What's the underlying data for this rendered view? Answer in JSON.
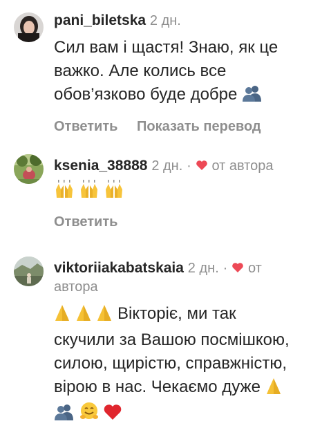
{
  "comments": [
    {
      "username": "pani_biletska",
      "time": "2 дн.",
      "text_lines": [
        "Сил вам і щастя! Знаю, як це",
        "важко. Але колись все",
        "обов’язково буде добре"
      ],
      "trailing_emoji": "hugging-people-icon",
      "actions": {
        "reply": "Ответить",
        "translate": "Показать перевод"
      }
    },
    {
      "username": "ksenia_38888",
      "time": "2 дн.",
      "separator": "·",
      "liked_by_author": "от автора",
      "emoji_row": [
        "raised-hands-icon",
        "raised-hands-icon",
        "raised-hands-icon"
      ],
      "actions": {
        "reply": "Ответить"
      }
    },
    {
      "username": "viktoriiakabatskaia",
      "time": "2 дн.",
      "separator": "·",
      "liked_by_author_line1": "от",
      "liked_by_author_line2": "автора",
      "text_line1": "Вікторіє, ми так",
      "text_lines": [
        "скучили за Вашою посмішкою,",
        "силою, щирістю, справжністю,",
        "вірою в нас. Чекаємо дуже"
      ],
      "leading_emoji": [
        "folded-hands-icon",
        "folded-hands-icon",
        "folded-hands-icon"
      ],
      "trailing_emoji": [
        "hugging-people-icon",
        "hugging-face-icon",
        "red-heart-icon"
      ]
    }
  ],
  "colors": {
    "text": "#262626",
    "secondary": "#8e8e8e",
    "heart": "#ed4956"
  }
}
